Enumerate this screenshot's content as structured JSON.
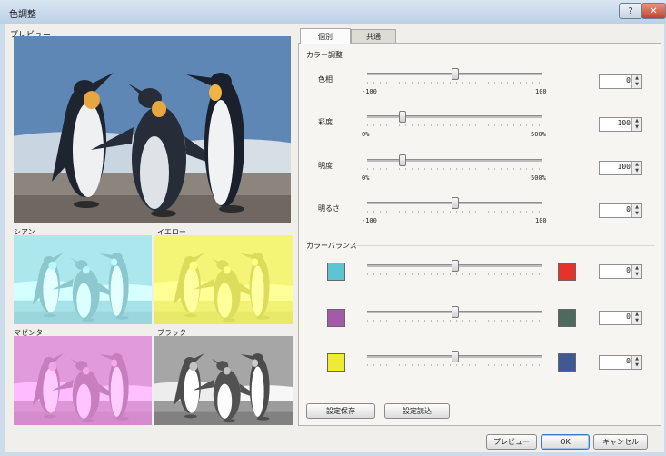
{
  "window": {
    "title": "色調整",
    "help": "?",
    "close": "✕"
  },
  "preview": {
    "label": "プレビュー",
    "cyan_label": "シアン",
    "yellow_label": "イエロー",
    "magenta_label": "マゼンタ",
    "black_label": "ブラック"
  },
  "tabs": [
    {
      "label": "個別"
    },
    {
      "label": "共通"
    }
  ],
  "color_adjust": {
    "title": "カラー調整",
    "rows": [
      {
        "label": "色相",
        "min": "-100",
        "max": "100",
        "value": "0",
        "level": 0.5
      },
      {
        "label": "彩度",
        "min": "0%",
        "max": "500%",
        "value": "100",
        "level": 0.2
      },
      {
        "label": "明度",
        "min": "0%",
        "max": "500%",
        "value": "100",
        "level": 0.2
      },
      {
        "label": "明るさ",
        "min": "-100",
        "max": "100",
        "value": "0",
        "level": 0.5
      }
    ]
  },
  "color_balance": {
    "title": "カラーバランス",
    "rows": [
      {
        "left_color": "#5fc4d2",
        "right_color": "#e5332a",
        "value": "0",
        "level": 0.5
      },
      {
        "left_color": "#a45aa9",
        "right_color": "#4d6a5e",
        "value": "0",
        "level": 0.5
      },
      {
        "left_color": "#efe938",
        "right_color": "#3f5a93",
        "value": "0",
        "level": 0.5
      }
    ]
  },
  "buttons": {
    "save": "設定保存",
    "load": "設定読込",
    "preview": "プレビュー",
    "ok": "OK",
    "cancel": "キャンセル"
  }
}
